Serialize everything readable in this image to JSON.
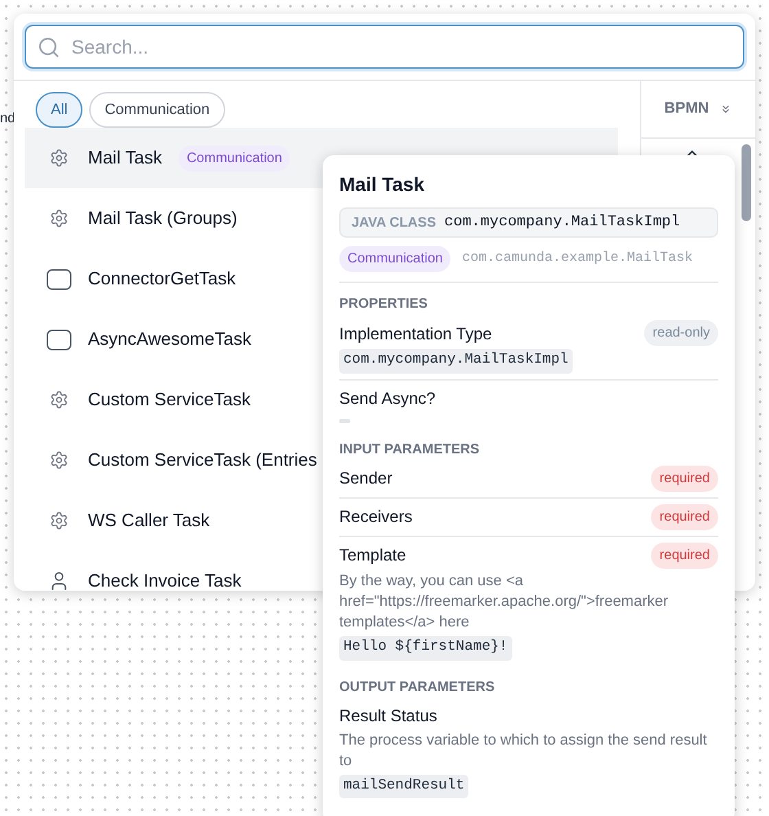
{
  "canvas": {
    "label": "nd"
  },
  "search": {
    "placeholder": "Search..."
  },
  "filters": [
    {
      "label": "All",
      "selected": true
    },
    {
      "label": "Communication",
      "selected": false
    }
  ],
  "sidebar": {
    "title": "BPMN"
  },
  "items": [
    {
      "label": "Mail Task",
      "kind": "service",
      "tag": "Communication",
      "selected": true
    },
    {
      "label": "Mail Task (Groups)",
      "kind": "service",
      "selected": false
    },
    {
      "label": "ConnectorGetTask",
      "kind": "task",
      "selected": false
    },
    {
      "label": "AsyncAwesomeTask",
      "kind": "task",
      "selected": false
    },
    {
      "label": "Custom ServiceTask",
      "kind": "service",
      "selected": false
    },
    {
      "label": "Custom ServiceTask (Entries",
      "kind": "service",
      "selected": false
    },
    {
      "label": "WS Caller Task",
      "kind": "service",
      "selected": false
    },
    {
      "label": "Check Invoice Task",
      "kind": "user",
      "selected": false
    }
  ],
  "details": {
    "title": "Mail Task",
    "class_label": "JAVA CLASS",
    "class_value": "com.mycompany.MailTaskImpl",
    "tag": "Communication",
    "id": "com.camunda.example.MailTask",
    "sections": [
      {
        "title": "PROPERTIES",
        "entries": [
          {
            "name": "Implementation Type",
            "badge": "read-only",
            "kind": "info",
            "value": "com.mycompany.MailTaskImpl"
          },
          {
            "name": "Send Async?",
            "empty_value": true
          }
        ]
      },
      {
        "title": "INPUT PARAMETERS",
        "entries": [
          {
            "name": "Sender",
            "badge": "required",
            "kind": "required"
          },
          {
            "name": "Receivers",
            "badge": "required",
            "kind": "required"
          },
          {
            "name": "Template",
            "badge": "required",
            "kind": "required",
            "description": "By the way, you can use <a href=\"https://freemarker.apache.org/\">freemarker templates</a> here",
            "value": "Hello ${firstName}!"
          }
        ]
      },
      {
        "title": "OUTPUT PARAMETERS",
        "entries": [
          {
            "name": "Result Status",
            "description": "The process variable to which to assign the send result to",
            "value": "mailSendResult"
          }
        ]
      }
    ]
  }
}
